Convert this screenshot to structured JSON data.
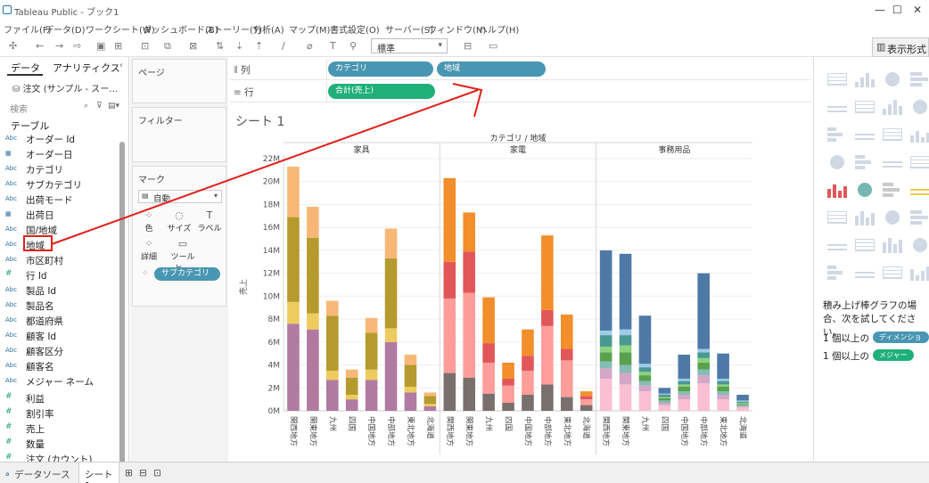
{
  "window": {
    "title": "Tableau Public - ブック1"
  },
  "menu": [
    "ファイル(F)",
    "データ(D)",
    "ワークシート(W)",
    "ダッシュボード(B)",
    "ストーリー(T)",
    "分析(A)",
    "マップ(M)",
    "書式設定(O)",
    "サーバー(S)",
    "ウィンドウ(N)",
    "ヘルプ(H)"
  ],
  "toolbar": {
    "fit_select": "標準",
    "show_me_label": "表示形式"
  },
  "left_panel": {
    "tabs": [
      "データ",
      "アナリティクス"
    ],
    "datasource": "注文 (サンプル - スー…",
    "search_placeholder": "検索",
    "tables_label": "テーブル",
    "fields": [
      {
        "icon": "Abc",
        "name": "オーダー Id",
        "kind": "dim"
      },
      {
        "icon": "▦",
        "name": "オーダー日",
        "kind": "dim"
      },
      {
        "icon": "Abc",
        "name": "カテゴリ",
        "kind": "dim"
      },
      {
        "icon": "Abc",
        "name": "サブカテゴリ",
        "kind": "dim"
      },
      {
        "icon": "Abc",
        "name": "出荷モード",
        "kind": "dim"
      },
      {
        "icon": "▦",
        "name": "出荷日",
        "kind": "dim"
      },
      {
        "icon": "Abc",
        "name": "国/地域",
        "kind": "dim"
      },
      {
        "icon": "Abc",
        "name": "地域",
        "kind": "dim"
      },
      {
        "icon": "Abc",
        "name": "市区町村",
        "kind": "dim"
      },
      {
        "icon": "#",
        "name": "行 Id",
        "kind": "dim"
      },
      {
        "icon": "Abc",
        "name": "製品 Id",
        "kind": "dim"
      },
      {
        "icon": "Abc",
        "name": "製品名",
        "kind": "dim"
      },
      {
        "icon": "Abc",
        "name": "都道府県",
        "kind": "dim"
      },
      {
        "icon": "Abc",
        "name": "顧客 Id",
        "kind": "dim"
      },
      {
        "icon": "Abc",
        "name": "顧客区分",
        "kind": "dim"
      },
      {
        "icon": "Abc",
        "name": "顧客名",
        "kind": "dim"
      },
      {
        "icon": "Abc",
        "name": "メジャー ネーム",
        "kind": "dim"
      },
      {
        "icon": "#",
        "name": "利益",
        "kind": "measure"
      },
      {
        "icon": "#",
        "name": "割引率",
        "kind": "measure"
      },
      {
        "icon": "#",
        "name": "売上",
        "kind": "measure"
      },
      {
        "icon": "#",
        "name": "数量",
        "kind": "measure"
      },
      {
        "icon": "#",
        "name": "注文 (カウント)",
        "kind": "measure"
      }
    ]
  },
  "cards": {
    "pages": "ページ",
    "filters": "フィルター",
    "marks": "マーク",
    "mark_type": "自動",
    "mark_buttons": [
      {
        "glyph": "⁘",
        "label": "色"
      },
      {
        "glyph": "◌",
        "label": "サイズ"
      },
      {
        "glyph": "T",
        "label": "ラベル"
      },
      {
        "glyph": "⁘",
        "label": "詳細"
      },
      {
        "glyph": "▭",
        "label": "ツールヒ…"
      }
    ],
    "color_pill": "サブカテゴリ"
  },
  "shelves": {
    "columns_label": "列",
    "rows_label": "行",
    "columns_pills": [
      "カテゴリ",
      "地域"
    ],
    "rows_pills": [
      "合計(売上)"
    ]
  },
  "sheet_title": "シート 1",
  "showme": {
    "hint": "積み上げ棒グラフの場合、次を試してください。",
    "req1_prefix": "1 個以上の",
    "req1_pill": "ディメンション",
    "req2_prefix": "1 個以上の",
    "req2_pill": "メジャー"
  },
  "bottom": {
    "datasource_tab": "データソース",
    "sheet_tab": "シート 1"
  },
  "colors": {
    "dim_pill": "#4996b2",
    "measure_pill": "#1fb07a",
    "annotation": "#e0201b"
  },
  "chart_data": {
    "type": "bar",
    "stacked": true,
    "title": "カテゴリ / 地域",
    "ylabel": "売上",
    "ylim": [
      0,
      22
    ],
    "yunit": "M",
    "yticks": [
      "0M",
      "2M",
      "4M",
      "6M",
      "8M",
      "10M",
      "12M",
      "14M",
      "16M",
      "18M",
      "20M",
      "22M"
    ],
    "panels": [
      {
        "category": "家具",
        "regions": [
          "関西地方",
          "関東地方",
          "九州",
          "四国",
          "中国地方",
          "中部地方",
          "東北地方",
          "北海道"
        ],
        "segment_colors": [
          "#b07aa1",
          "#eecb5e",
          "#b59a2e",
          "#f7b877"
        ],
        "stacks": [
          [
            7.6,
            1.9,
            7.4,
            4.4
          ],
          [
            7.1,
            1.4,
            6.6,
            2.7
          ],
          [
            2.7,
            0.8,
            4.8,
            1.3
          ],
          [
            1.0,
            0.4,
            1.5,
            0.7
          ],
          [
            2.7,
            0.9,
            3.2,
            1.3
          ],
          [
            6.0,
            1.2,
            6.1,
            2.6
          ],
          [
            1.6,
            0.5,
            1.9,
            0.9
          ],
          [
            0.4,
            0.2,
            0.7,
            0.3
          ]
        ]
      },
      {
        "category": "家電",
        "regions": [
          "関西地方",
          "関東地方",
          "九州",
          "四国",
          "中国地方",
          "中部地方",
          "東北地方",
          "北海道"
        ],
        "segment_colors": [
          "#79706e",
          "#ff9d9a",
          "#e15759",
          "#f28e2b"
        ],
        "stacks": [
          [
            3.3,
            6.5,
            3.2,
            7.3
          ],
          [
            2.9,
            7.4,
            3.6,
            3.4
          ],
          [
            1.5,
            2.7,
            1.7,
            4.0
          ],
          [
            0.7,
            1.5,
            0.6,
            1.4
          ],
          [
            1.4,
            2.1,
            1.3,
            2.3
          ],
          [
            2.3,
            5.1,
            1.4,
            6.5
          ],
          [
            1.2,
            3.2,
            1.0,
            3.0
          ],
          [
            0.5,
            0.5,
            0.3,
            0.4
          ]
        ]
      },
      {
        "category": "事務用品",
        "regions": [
          "関西地方",
          "関東地方",
          "九州",
          "四国",
          "中国地方",
          "中部地方",
          "東北地方",
          "北海道"
        ],
        "segment_colors": [
          "#fabfd2",
          "#d4a6c8",
          "#86bcb6",
          "#59a14f",
          "#8cd17d",
          "#499894",
          "#a0cbe8",
          "#4e79a7"
        ],
        "stacks": [
          [
            2.8,
            0.9,
            0.6,
            0.8,
            0.5,
            1.0,
            0.4,
            7.0
          ],
          [
            2.3,
            1.0,
            0.7,
            1.1,
            0.6,
            0.9,
            0.5,
            6.6
          ],
          [
            1.7,
            0.5,
            0.4,
            0.5,
            0.3,
            0.4,
            0.3,
            4.2
          ],
          [
            0.5,
            0.2,
            0.2,
            0.2,
            0.1,
            0.2,
            0.1,
            0.5
          ],
          [
            1.0,
            0.4,
            0.3,
            0.4,
            0.2,
            0.3,
            0.2,
            2.1
          ],
          [
            2.4,
            0.7,
            0.5,
            0.6,
            0.4,
            0.5,
            0.3,
            6.6
          ],
          [
            1.0,
            0.4,
            0.3,
            0.4,
            0.2,
            0.3,
            0.2,
            2.2
          ],
          [
            0.3,
            0.1,
            0.1,
            0.1,
            0.1,
            0.1,
            0.1,
            0.5
          ]
        ]
      }
    ]
  }
}
